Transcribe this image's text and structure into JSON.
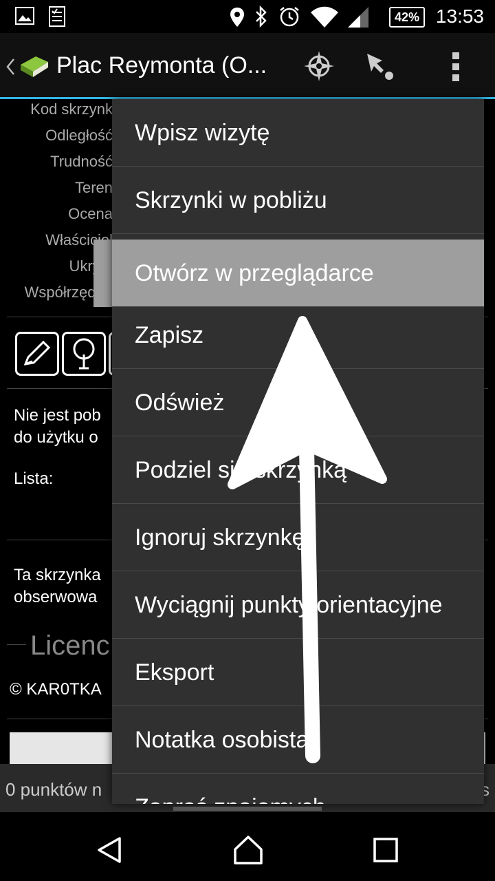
{
  "status_bar": {
    "time": "13:53",
    "battery": "42%"
  },
  "action_bar": {
    "title": "Plac Reymonta (O..."
  },
  "details": {
    "labels": [
      "Kod skrzynk",
      "Odległość",
      "Trudność",
      "Teren",
      "Ocena",
      "Właściciel",
      "Ukryta",
      "Współrzędne"
    ]
  },
  "body": {
    "text1_line1": "Nie jest pob",
    "text1_line2": "do użytku o",
    "lista": "Lista:",
    "text2_line1": "Ta skrzynka",
    "text2_line2": "obserwowa",
    "licence": "Licenc",
    "copyright": "© KAR0TKA"
  },
  "bottom_strip": {
    "text": "0 punktów n",
    "right": "s"
  },
  "menu": {
    "items": [
      {
        "label": "Wpisz wizytę"
      },
      {
        "label": "Skrzynki w pobliżu"
      },
      {
        "label": "Otwórz w przeglądarce"
      },
      {
        "label": "Zapisz"
      },
      {
        "label": "Odśwież"
      },
      {
        "label": "Podziel się skrzynką"
      },
      {
        "label": "Ignoruj skrzynkę"
      },
      {
        "label": "Wyciągnij punkty orientacyjne"
      },
      {
        "label": "Eksport"
      },
      {
        "label": "Notatka osobista"
      },
      {
        "label": "Zaproś znajomych"
      }
    ]
  },
  "colors": {
    "accent": "#33b5e5",
    "menu_bg": "#303030",
    "highlight": "#9e9e9e"
  }
}
